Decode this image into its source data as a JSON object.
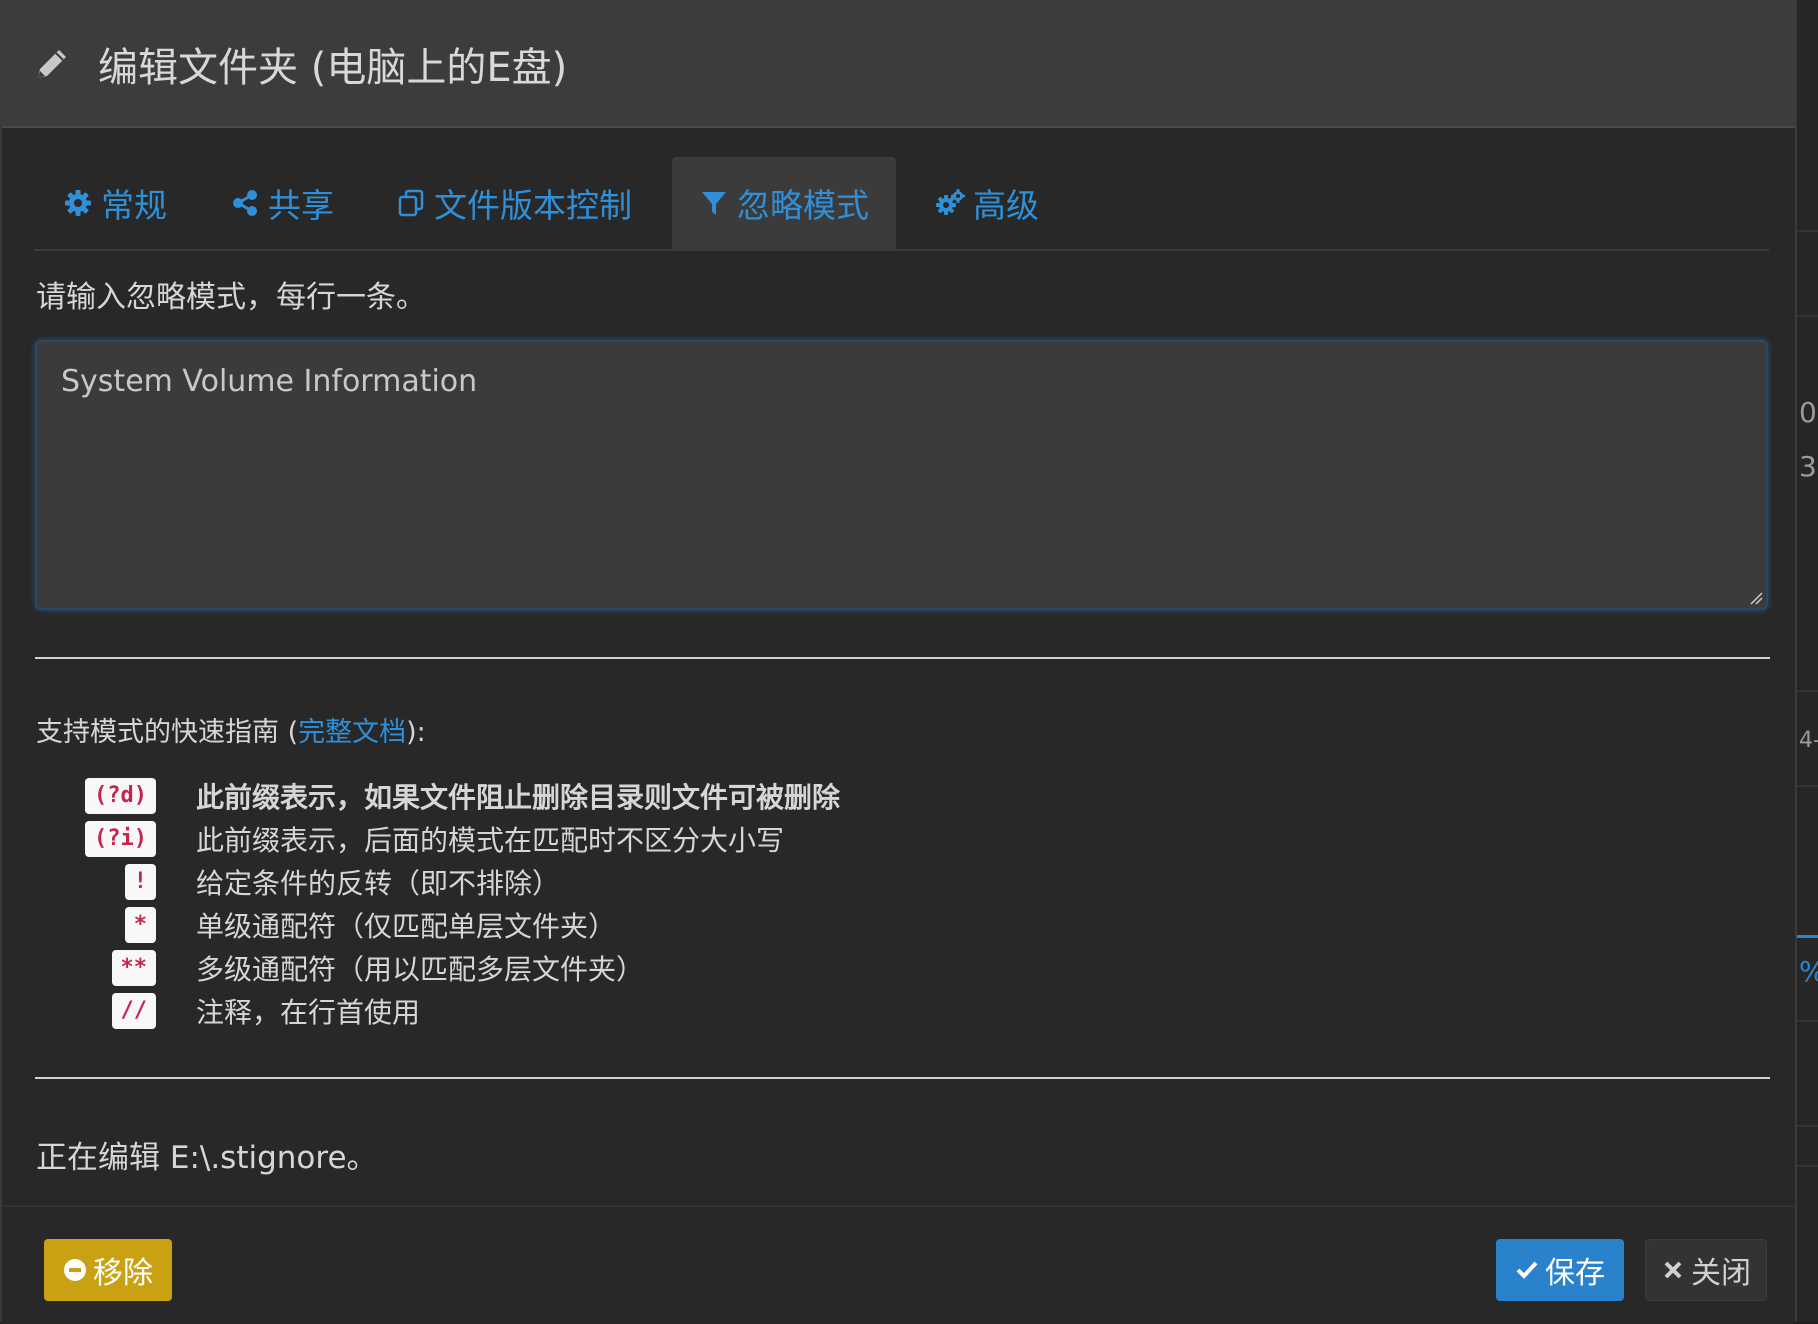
{
  "header": {
    "title": "编辑文件夹 (电脑上的E盘)",
    "icon": "pencil-icon"
  },
  "tabs": [
    {
      "label": "常规",
      "icon": "gear-icon",
      "active": false
    },
    {
      "label": "共享",
      "icon": "share-icon",
      "active": false
    },
    {
      "label": "文件版本控制",
      "icon": "copy-icon",
      "active": false
    },
    {
      "label": "忽略模式",
      "icon": "filter-icon",
      "active": true
    },
    {
      "label": "高级",
      "icon": "gears-icon",
      "active": false
    }
  ],
  "ignore_panel": {
    "prompt": "请输入忽略模式，每行一条。",
    "textarea_value": "System Volume Information",
    "guide_heading_before": "支持模式的快速指南 (",
    "guide_link": "完整文档",
    "guide_heading_after": "):",
    "patterns": [
      {
        "code": "(?d)",
        "desc": "此前缀表示，如果文件阻止删除目录则文件可被删除",
        "bold": true
      },
      {
        "code": "(?i)",
        "desc": "此前缀表示，后面的模式在匹配时不区分大小写"
      },
      {
        "code": "!",
        "desc": "给定条件的反转（即不排除）"
      },
      {
        "code": "*",
        "desc": "单级通配符（仅匹配单层文件夹）"
      },
      {
        "code": "**",
        "desc": "多级通配符（用以匹配多层文件夹）"
      },
      {
        "code": "//",
        "desc": "注释，在行首使用"
      }
    ],
    "editing_note": "正在编辑 E:\\.stignore。"
  },
  "footer": {
    "remove_label": "移除",
    "save_label": "保存",
    "close_label": "关闭"
  },
  "backdrop_fragments": [
    "0",
    "3",
    "4-",
    "%"
  ],
  "colors": {
    "accent_blue": "#2f8fd8",
    "warning_yellow": "#c9a113",
    "primary_blue": "#2a82cc",
    "code_red": "#c7254e"
  }
}
